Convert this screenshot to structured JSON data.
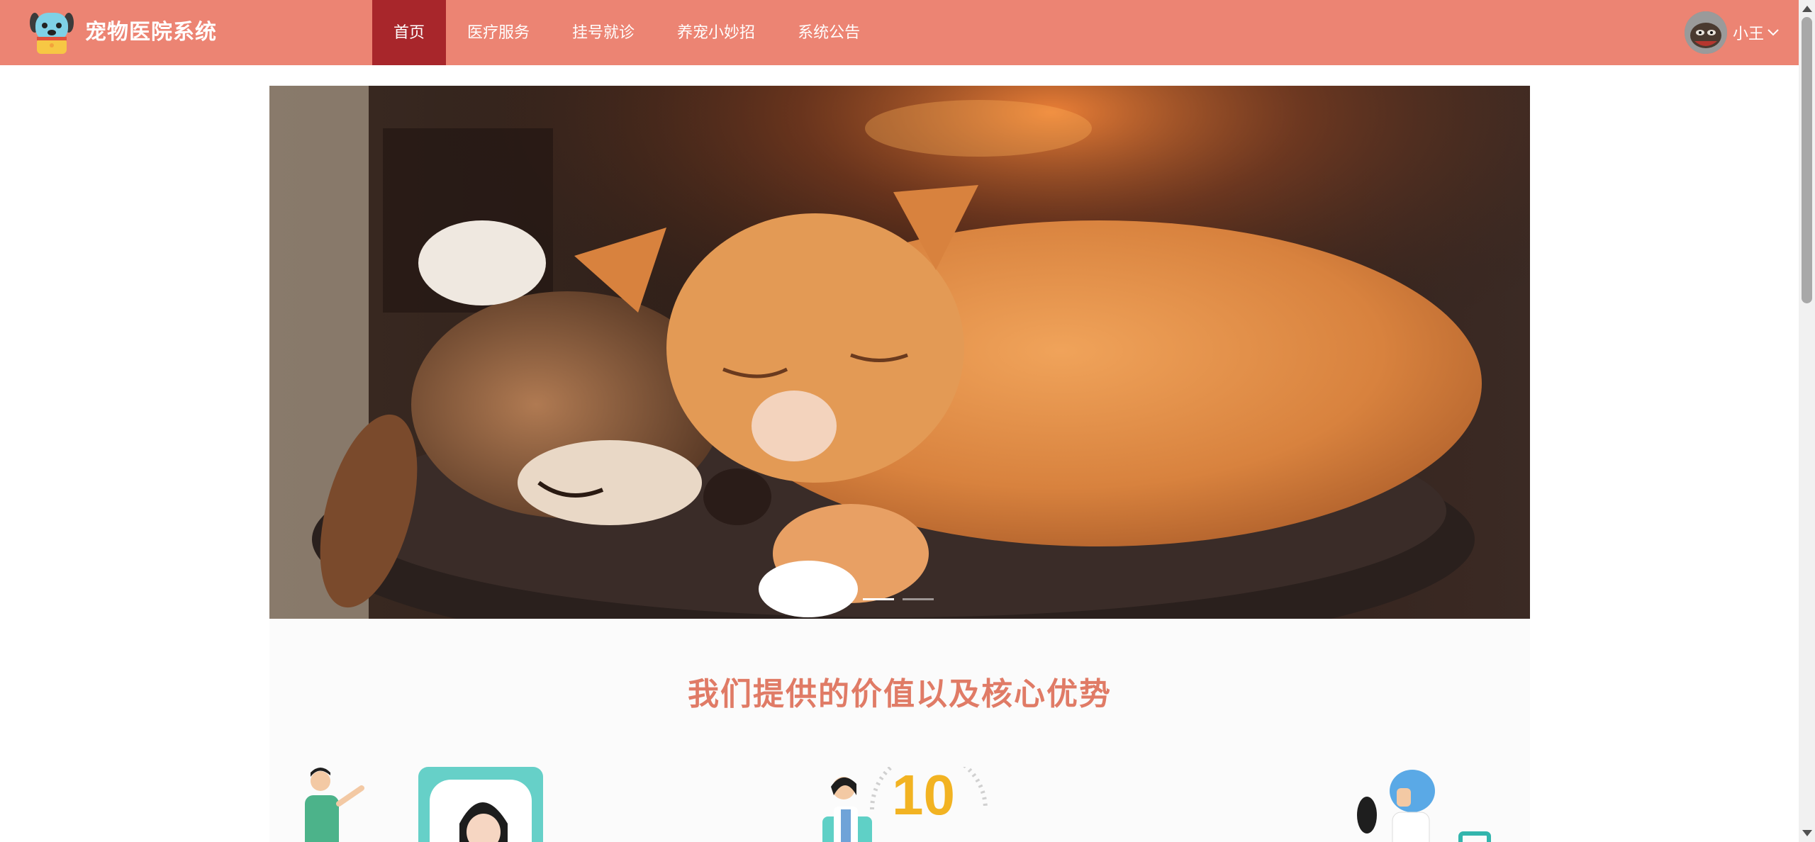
{
  "app": {
    "brand": "宠物医院系统",
    "logo_icon": "dog-face-icon"
  },
  "nav": {
    "items": [
      {
        "label": "首页",
        "active": true
      },
      {
        "label": "医疗服务",
        "active": false
      },
      {
        "label": "挂号就诊",
        "active": false
      },
      {
        "label": "养宠小妙招",
        "active": false
      },
      {
        "label": "系统公告",
        "active": false
      }
    ]
  },
  "user": {
    "name": "小王",
    "avatar_icon": "user-avatar",
    "menu_icon": "chevron-down-icon"
  },
  "banner": {
    "image": "dog-and-cat-sleeping-photo",
    "slides_count": 2,
    "active_slide": 0
  },
  "section": {
    "title": "我们提供的价值以及核心优势",
    "cards": [
      {
        "illustration": "doctor-consultation-illustration"
      },
      {
        "illustration": "fast-service-10-illustration",
        "badge": "10"
      },
      {
        "illustration": "delivery-courier-illustration"
      }
    ]
  },
  "colors": {
    "header_bg": "#ec8473",
    "nav_active_bg": "#a8262b",
    "section_title": "#e07b66"
  }
}
